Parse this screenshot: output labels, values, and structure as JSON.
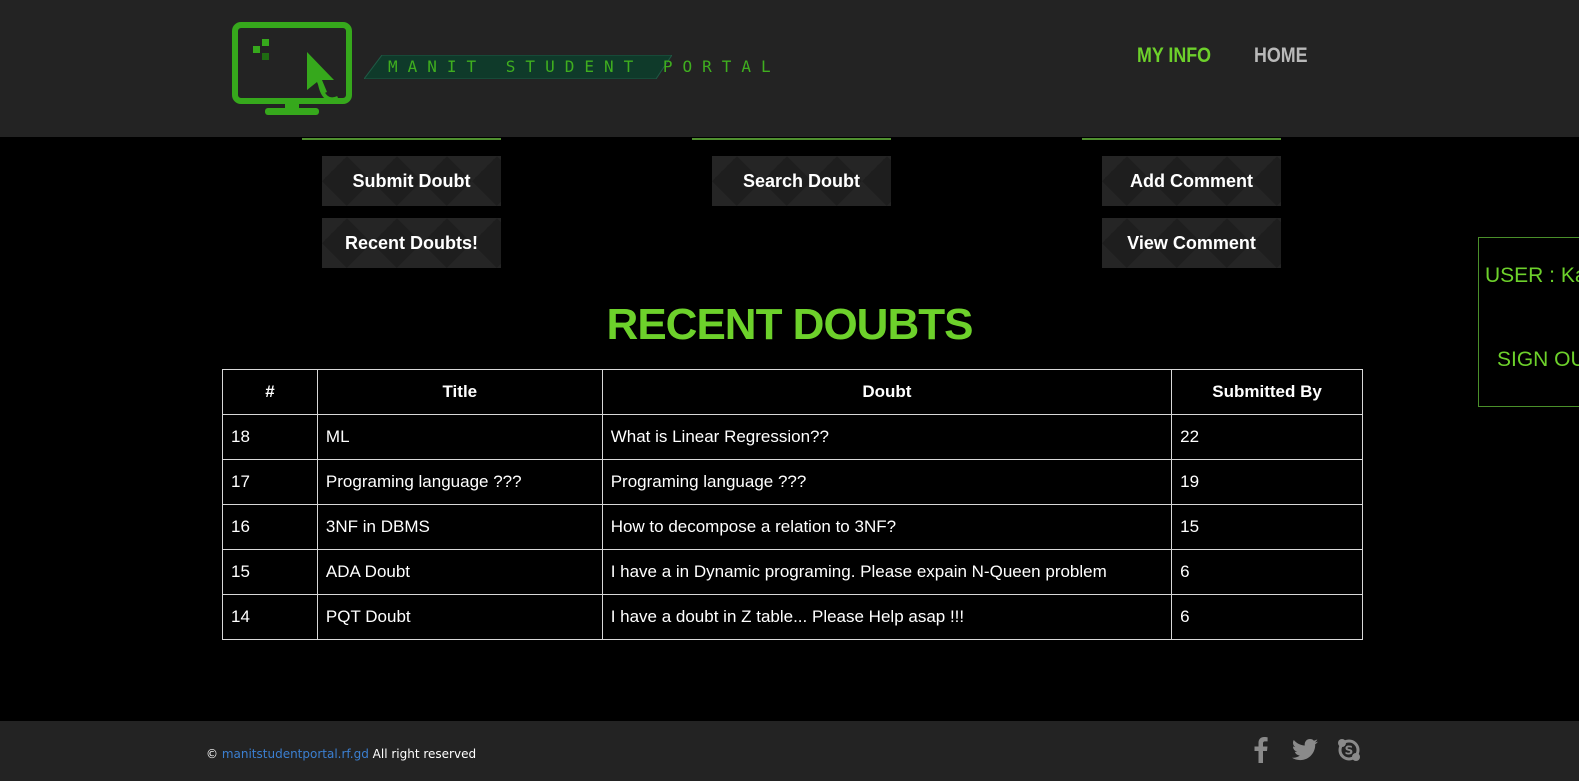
{
  "header": {
    "logo_text": "MANIT STUDENT PORTAL",
    "nav": [
      {
        "label": "MY INFO"
      },
      {
        "label": "HOME"
      }
    ]
  },
  "actions": {
    "submit_doubt": "Submit Doubt",
    "search_doubt": "Search Doubt",
    "add_comment": "Add Comment",
    "recent_doubts": "Recent Doubts!",
    "view_comment": "View Comment"
  },
  "section": {
    "title": "RECENT DOUBTS"
  },
  "table": {
    "headers": [
      "#",
      "Title",
      "Doubt",
      "Submitted By"
    ],
    "rows": [
      [
        "18",
        "ML",
        "What is Linear Regression??",
        "22"
      ],
      [
        "17",
        "Programing language ???",
        "Programing language ???",
        "19"
      ],
      [
        "16",
        "3NF in DBMS",
        "How to decompose a relation to 3NF?",
        "15"
      ],
      [
        "15",
        "ADA Doubt",
        "I have a in Dynamic programing. Please expain N-Queen problem",
        "6"
      ],
      [
        "14",
        "PQT Doubt",
        "I have a doubt in Z table... Please Help asap !!!",
        "6"
      ]
    ]
  },
  "user_panel": {
    "user_label": "USER : Karan",
    "sign_out": "SIGN OUT"
  },
  "footer": {
    "copyright_symbol": "©",
    "site": "manitstudentportal.rf.gd",
    "rights": "All right reserved",
    "social_icons": [
      "facebook-icon",
      "twitter-icon",
      "skype-icon"
    ]
  },
  "colors": {
    "accent": "#6dd12b",
    "header_bg": "#232323",
    "page_bg": "#000000",
    "link": "#3b7fd1"
  }
}
